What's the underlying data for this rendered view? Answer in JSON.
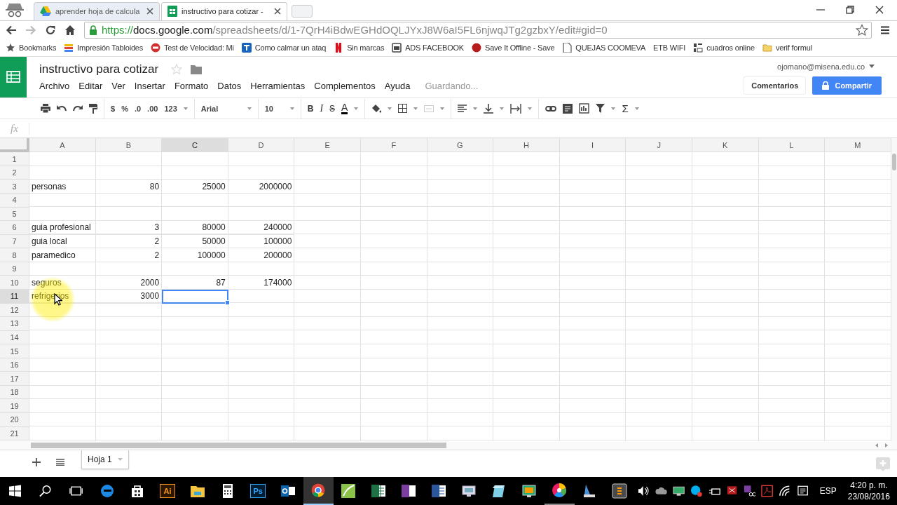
{
  "browser_tabs": [
    {
      "title": "aprender hoja de calcula",
      "selected": false
    },
    {
      "title": "instructivo para cotizar -",
      "selected": true
    }
  ],
  "address_bar": {
    "scheme": "https://",
    "host": "docs.google.com",
    "path": "/spreadsheets/d/1-7QrH4iBdwEGHdOQLJYxJ8W6aI5FL6njwqJTg2gzbxY/edit#gid=0"
  },
  "bookmarks": [
    {
      "label": "Bookmarks"
    },
    {
      "label": "Impresión Tabloides"
    },
    {
      "label": "Test de Velocidad: Mi"
    },
    {
      "label": "Como calmar un ataq"
    },
    {
      "label": "Sin marcas"
    },
    {
      "label": "ADS FACEBOOK"
    },
    {
      "label": "Save It Offline - Save"
    },
    {
      "label": "QUEJAS COOMEVA"
    },
    {
      "label": "ETB WIFI"
    },
    {
      "label": "cuadros online"
    },
    {
      "label": "verif formul"
    }
  ],
  "document": {
    "title": "instructivo para cotizar",
    "status": "Guardando...",
    "account": "ojomano@misena.edu.co"
  },
  "menu": [
    "Archivo",
    "Editar",
    "Ver",
    "Insertar",
    "Formato",
    "Datos",
    "Herramientas",
    "Complementos",
    "Ayuda"
  ],
  "buttons": {
    "comments": "Comentarios",
    "share": "Compartir"
  },
  "toolbar": {
    "currency": "$",
    "percent": "%",
    "decrease_decimals": ".0",
    "increase_decimals": ".00",
    "number_format": "123",
    "font": "Arial",
    "font_size": "10",
    "bold": "B",
    "italic": "I",
    "strikethrough": "S",
    "text_color": "A",
    "functions": "Σ"
  },
  "formula_bar": {
    "label": "fx"
  },
  "columns": [
    {
      "label": "A",
      "selected": false
    },
    {
      "label": "B",
      "selected": false
    },
    {
      "label": "C",
      "selected": true
    },
    {
      "label": "D",
      "selected": false
    },
    {
      "label": "E",
      "selected": false
    },
    {
      "label": "F",
      "selected": false
    },
    {
      "label": "G",
      "selected": false
    },
    {
      "label": "H",
      "selected": false
    },
    {
      "label": "I",
      "selected": false
    },
    {
      "label": "J",
      "selected": false
    },
    {
      "label": "K",
      "selected": false
    },
    {
      "label": "L",
      "selected": false
    },
    {
      "label": "M",
      "selected": false
    }
  ],
  "rows": [
    {
      "label": "1",
      "selected": false
    },
    {
      "label": "2",
      "selected": false
    },
    {
      "label": "3",
      "selected": false,
      "cells": {
        "A": "personas",
        "B": "80",
        "C": "25000",
        "D": "2000000"
      }
    },
    {
      "label": "4",
      "selected": false
    },
    {
      "label": "5",
      "selected": false
    },
    {
      "label": "6",
      "selected": false,
      "cells": {
        "A": "guia profesional",
        "B": "3",
        "C": "80000",
        "D": "240000"
      }
    },
    {
      "label": "7",
      "selected": false,
      "cells": {
        "A": "guia local",
        "B": "2",
        "C": "50000",
        "D": "100000"
      }
    },
    {
      "label": "8",
      "selected": false,
      "cells": {
        "A": "paramedico",
        "B": "2",
        "C": "100000",
        "D": "200000"
      }
    },
    {
      "label": "9",
      "selected": false
    },
    {
      "label": "10",
      "selected": false,
      "cells": {
        "A": "seguros",
        "B": "2000",
        "C": "87",
        "D": "174000"
      }
    },
    {
      "label": "11",
      "selected": true,
      "cells": {
        "A": "refrigerios",
        "B": "3000"
      }
    },
    {
      "label": "12",
      "selected": false
    },
    {
      "label": "13",
      "selected": false
    },
    {
      "label": "14",
      "selected": false
    },
    {
      "label": "15",
      "selected": false
    },
    {
      "label": "16",
      "selected": false
    },
    {
      "label": "17",
      "selected": false
    },
    {
      "label": "18",
      "selected": false
    },
    {
      "label": "19",
      "selected": false
    },
    {
      "label": "20",
      "selected": false
    },
    {
      "label": "21",
      "selected": false
    }
  ],
  "sheet_tabs": [
    {
      "label": "Hoja 1",
      "selected": true
    }
  ],
  "taskbar": {
    "apps": [
      {
        "running": false,
        "selected": false
      },
      {
        "running": false,
        "selected": false
      },
      {
        "glyph": "Ai",
        "running": false,
        "selected": false
      },
      {
        "running": false,
        "selected": false
      },
      {
        "running": false,
        "selected": false
      },
      {
        "glyph": "Ps",
        "running": false,
        "selected": false
      },
      {
        "running": false,
        "selected": false
      },
      {
        "running": true,
        "selected": true
      },
      {
        "running": false,
        "selected": false
      },
      {
        "running": false,
        "selected": false
      },
      {
        "running": false,
        "selected": false
      },
      {
        "running": false,
        "selected": false
      },
      {
        "running": false,
        "selected": false
      },
      {
        "running": false,
        "selected": false
      },
      {
        "running": false,
        "selected": false
      },
      {
        "running": true,
        "selected": false
      },
      {
        "running": false,
        "selected": false
      },
      {
        "running": false,
        "selected": false
      }
    ],
    "language": "ESP",
    "time": "4:20 p. m.",
    "date": "23/08/2016"
  }
}
